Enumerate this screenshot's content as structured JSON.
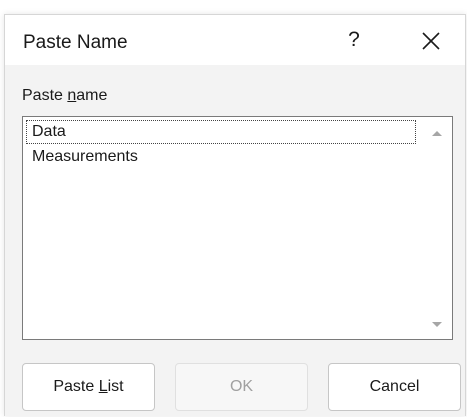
{
  "dialog": {
    "title": "Paste Name",
    "help_label": "?",
    "close_icon": "close-icon"
  },
  "section": {
    "label_prefix": "Paste ",
    "label_underlined": "n",
    "label_suffix": "ame"
  },
  "names": {
    "items": [
      "Data",
      "Measurements"
    ],
    "selected": "Data"
  },
  "buttons": {
    "paste_list_prefix": "Paste ",
    "paste_list_underlined": "L",
    "paste_list_suffix": "ist",
    "ok": "OK",
    "cancel": "Cancel"
  },
  "colors": {
    "dialog_background": "#f3f3f3",
    "titlebar_background": "#ffffff",
    "disabled_text": "#a0a0a0"
  }
}
